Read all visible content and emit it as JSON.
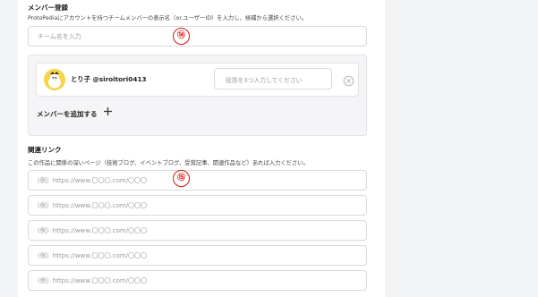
{
  "members": {
    "title": "メンバー登録",
    "help": "ProtoPediaにアカウントを持つチームメンバーの表示名（or.ユーザーID）を入力し、候補から選択ください。",
    "team_placeholder": "チーム名を入力",
    "member": {
      "name": "とり子 @siroitori0413",
      "role_placeholder": "役割を3つ入力してください"
    },
    "add_label": "メンバーを追加する",
    "add_icon": "plus-icon"
  },
  "links": {
    "title": "関連リンク",
    "help": "この作品に関係の深いページ（技術ブログ、イベントブログ、受賞記事、関連作品など）あれば入力ください。",
    "placeholders": [
      "(例）https://www.〇〇〇.com/〇〇〇",
      "(例）https://www.〇〇〇.com/〇〇〇",
      "(例）https://www.〇〇〇.com/〇〇〇",
      "(例）https://www.〇〇〇.com/〇〇〇",
      "(例）https://www.〇〇〇.com/〇〇〇"
    ]
  },
  "annotations": {
    "marker_14": "⑭",
    "marker_15": "⑮",
    "color": "#d4140f"
  }
}
